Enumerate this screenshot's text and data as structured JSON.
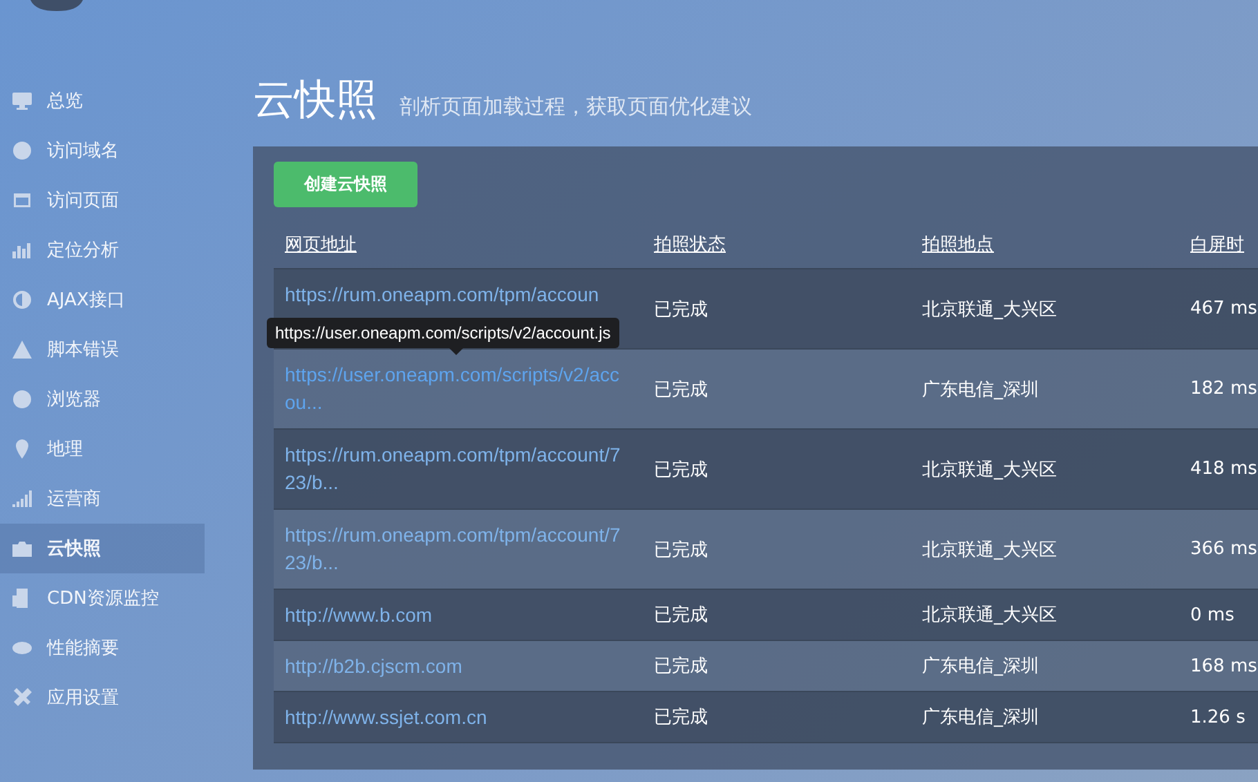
{
  "sidebar": {
    "items": [
      {
        "label": "总览",
        "selected": false
      },
      {
        "label": "访问域名",
        "selected": false
      },
      {
        "label": "访问页面",
        "selected": false
      },
      {
        "label": "定位分析",
        "selected": false
      },
      {
        "label": "AJAX接口",
        "selected": false
      },
      {
        "label": "脚本错误",
        "selected": false
      },
      {
        "label": "浏览器",
        "selected": false
      },
      {
        "label": "地理",
        "selected": false
      },
      {
        "label": "运营商",
        "selected": false
      },
      {
        "label": "云快照",
        "selected": true
      },
      {
        "label": "CDN资源监控",
        "selected": false
      },
      {
        "label": "性能摘要",
        "selected": false
      },
      {
        "label": "应用设置",
        "selected": false
      }
    ]
  },
  "page": {
    "title": "云快照",
    "subtitle": "剖析页面加载过程，获取页面优化建议"
  },
  "create_button": "创建云快照",
  "table": {
    "columns": [
      "网页地址",
      "拍照状态",
      "拍照地点",
      "白屏时"
    ],
    "rows": [
      {
        "url": "https://rum.oneapm.com/tpm/accoun",
        "status": "已完成",
        "location": "北京联通_大兴区",
        "time": "467 ms",
        "hovered": false
      },
      {
        "url": "https://user.oneapm.com/scripts/v2/accou...",
        "status": "已完成",
        "location": "广东电信_深圳",
        "time": "182 ms",
        "hovered": true
      },
      {
        "url": "https://rum.oneapm.com/tpm/account/723/b...",
        "status": "已完成",
        "location": "北京联通_大兴区",
        "time": "418 ms",
        "hovered": false
      },
      {
        "url": "https://rum.oneapm.com/tpm/account/723/b...",
        "status": "已完成",
        "location": "北京联通_大兴区",
        "time": "366 ms",
        "hovered": false
      },
      {
        "url": "http://www.b.com",
        "status": "已完成",
        "location": "北京联通_大兴区",
        "time": "0 ms",
        "hovered": false
      },
      {
        "url": "http://b2b.cjscm.com",
        "status": "已完成",
        "location": "广东电信_深圳",
        "time": "168 ms",
        "hovered": false
      },
      {
        "url": "http://www.ssjet.com.cn",
        "status": "已完成",
        "location": "广东电信_深圳",
        "time": "1.26 s",
        "hovered": false
      }
    ]
  },
  "tooltip": "https://user.oneapm.com/scripts/v2/account.js"
}
